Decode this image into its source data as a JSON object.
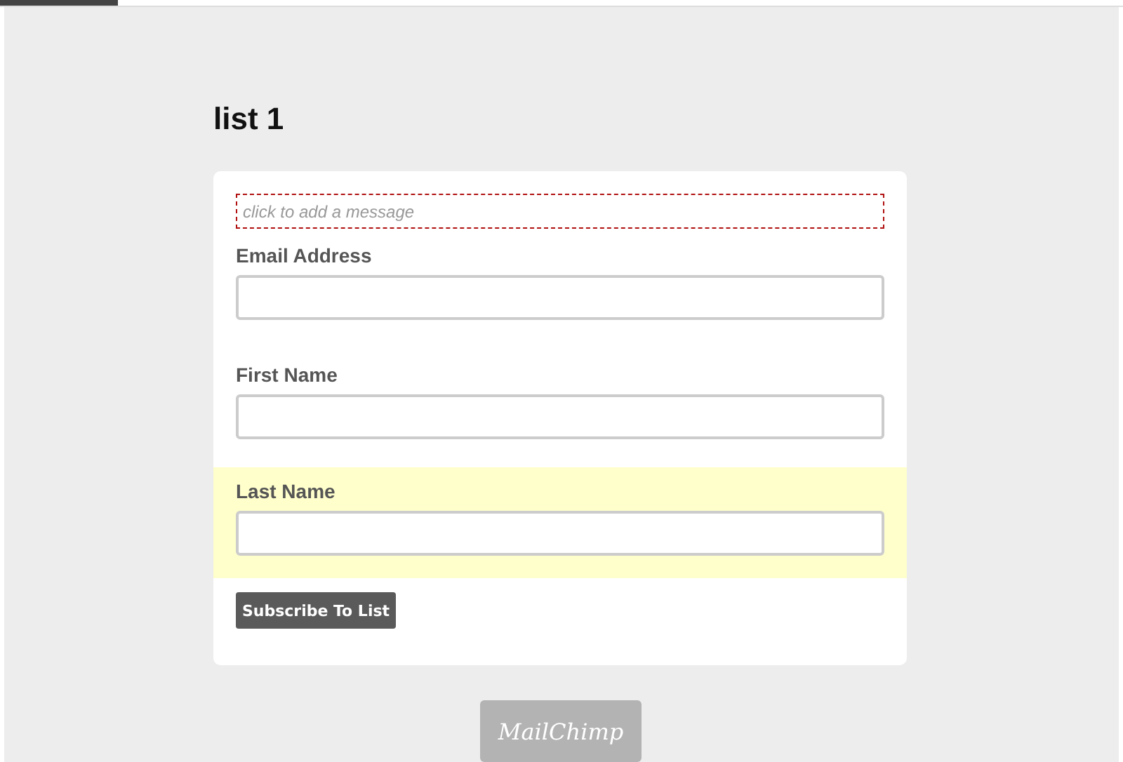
{
  "title": "list 1",
  "message": {
    "placeholder": "click to add a message"
  },
  "fields": [
    {
      "label": "Email Address",
      "highlighted": false
    },
    {
      "label": "First Name",
      "highlighted": false
    },
    {
      "label": "Last Name",
      "highlighted": true
    }
  ],
  "button": "Subscribe To List",
  "badge": "MailChimp"
}
